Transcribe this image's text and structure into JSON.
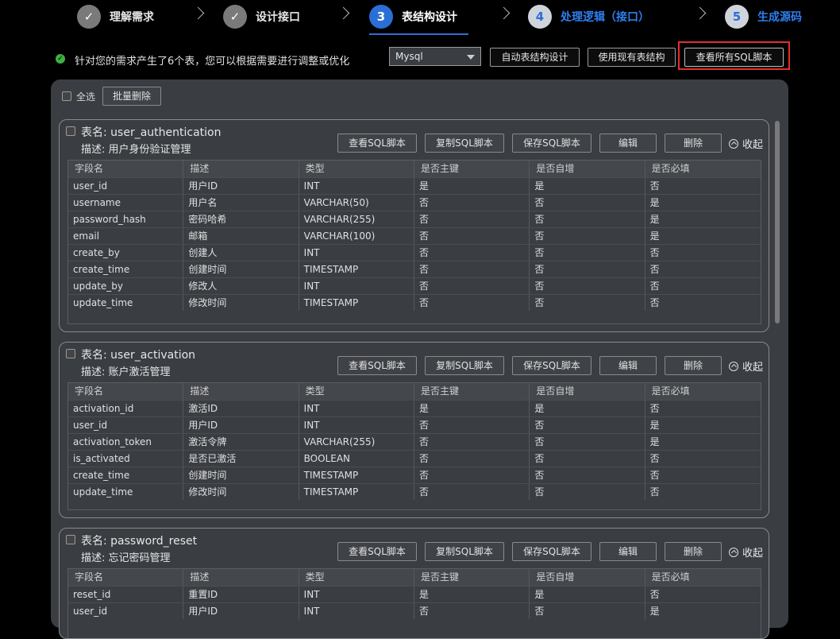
{
  "steps": [
    {
      "num": "✓",
      "label": "理解需求",
      "state": "done"
    },
    {
      "num": "✓",
      "label": "设计接口",
      "state": "done"
    },
    {
      "num": "3",
      "label": "表结构设计",
      "state": "active"
    },
    {
      "num": "4",
      "label": "处理逻辑（接口）",
      "state": "todo"
    },
    {
      "num": "5",
      "label": "生成源码",
      "state": "todo"
    }
  ],
  "info": {
    "message": "针对您的需求产生了6个表，您可以根据需要进行调整或优化",
    "db_type": "Mysql",
    "auto_design_label": "自动表结构设计",
    "use_existing_label": "使用现有表结构",
    "view_all_sql_label": "查看所有SQL脚本"
  },
  "panel": {
    "select_all_label": "全选",
    "batch_delete_label": "批量删除"
  },
  "card_labels": {
    "name_prefix": "表名: ",
    "desc_prefix": "描述: ",
    "view_sql": "查看SQL脚本",
    "copy_sql": "复制SQL脚本",
    "save_sql": "保存SQL脚本",
    "edit": "编辑",
    "delete": "删除",
    "collapse": "收起"
  },
  "columns": [
    "字段名",
    "描述",
    "类型",
    "是否主键",
    "是否自增",
    "是否必填"
  ],
  "tables": [
    {
      "name": "表名: user_authentication",
      "desc": "描述: 用户身份验证管理",
      "rows": [
        [
          "user_id",
          "用户ID",
          "INT",
          "是",
          "是",
          "否"
        ],
        [
          "username",
          "用户名",
          "VARCHAR(50)",
          "否",
          "否",
          "是"
        ],
        [
          "password_hash",
          "密码哈希",
          "VARCHAR(255)",
          "否",
          "否",
          "是"
        ],
        [
          "email",
          "邮箱",
          "VARCHAR(100)",
          "否",
          "否",
          "是"
        ],
        [
          "create_by",
          "创建人",
          "INT",
          "否",
          "否",
          "否"
        ],
        [
          "create_time",
          "创建时间",
          "TIMESTAMP",
          "否",
          "否",
          "否"
        ],
        [
          "update_by",
          "修改人",
          "INT",
          "否",
          "否",
          "否"
        ],
        [
          "update_time",
          "修改时间",
          "TIMESTAMP",
          "否",
          "否",
          "否"
        ]
      ]
    },
    {
      "name": "表名: user_activation",
      "desc": "描述: 账户激活管理",
      "rows": [
        [
          "activation_id",
          "激活ID",
          "INT",
          "是",
          "是",
          "否"
        ],
        [
          "user_id",
          "用户ID",
          "INT",
          "否",
          "否",
          "是"
        ],
        [
          "activation_token",
          "激活令牌",
          "VARCHAR(255)",
          "否",
          "否",
          "是"
        ],
        [
          "is_activated",
          "是否已激活",
          "BOOLEAN",
          "否",
          "否",
          "否"
        ],
        [
          "create_time",
          "创建时间",
          "TIMESTAMP",
          "否",
          "否",
          "否"
        ],
        [
          "update_time",
          "修改时间",
          "TIMESTAMP",
          "否",
          "否",
          "否"
        ]
      ]
    },
    {
      "name": "表名: password_reset",
      "desc": "描述: 忘记密码管理",
      "rows": [
        [
          "reset_id",
          "重置ID",
          "INT",
          "是",
          "是",
          "否"
        ],
        [
          "user_id",
          "用户ID",
          "INT",
          "否",
          "否",
          "是"
        ]
      ]
    }
  ]
}
